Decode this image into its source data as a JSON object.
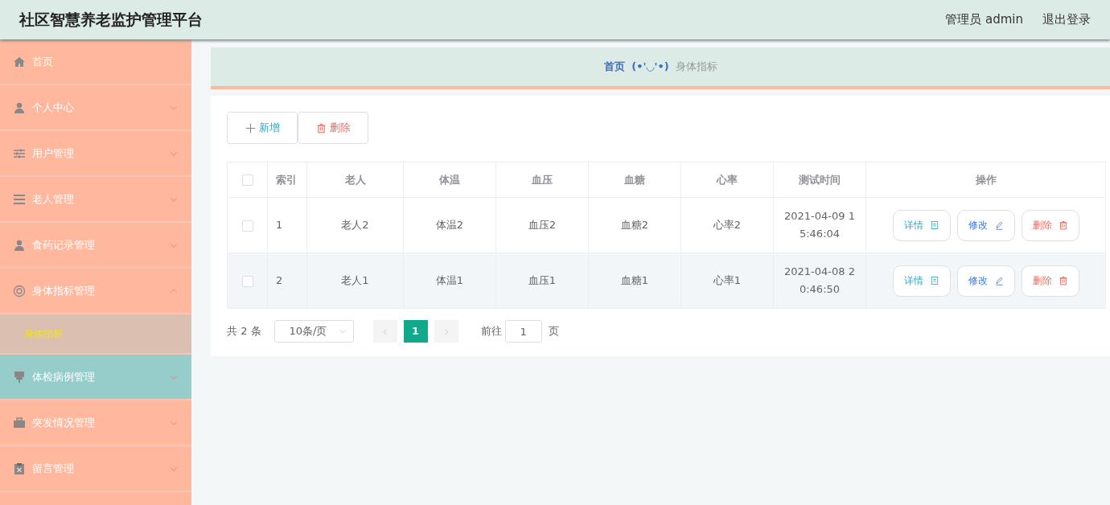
{
  "header": {
    "title": "社区智慧养老监护管理平台",
    "user": "管理员 admin",
    "logout": "退出登录"
  },
  "sidebar": {
    "items": [
      {
        "label": "首页",
        "hovered": false
      },
      {
        "label": "个人中心",
        "expanded": false,
        "hovered": false
      },
      {
        "label": "用户管理",
        "expanded": false,
        "hovered": false
      },
      {
        "label": "老人管理",
        "expanded": false,
        "hovered": false
      },
      {
        "label": "食药记录管理",
        "expanded": false,
        "hovered": false
      },
      {
        "label": "身体指标管理",
        "expanded": true,
        "hovered": false,
        "children": [
          {
            "label": "身体指标",
            "selected": true
          }
        ]
      },
      {
        "label": "体检病例管理",
        "expanded": false,
        "hovered": true
      },
      {
        "label": "突发情况管理",
        "expanded": false,
        "hovered": false
      },
      {
        "label": "留言管理",
        "expanded": false,
        "hovered": false
      }
    ]
  },
  "breadcrumb": {
    "home": "首页",
    "separator": "(•'◡'•)",
    "current": "身体指标"
  },
  "toolbar": {
    "add": "新增",
    "delete": "删除"
  },
  "table": {
    "select_all_checked": false,
    "columns": [
      "索引",
      "老人",
      "体温",
      "血压",
      "血糖",
      "心率",
      "测试时间",
      "操作"
    ],
    "rows": [
      {
        "checked": false,
        "cells": [
          "1",
          "老人2",
          "体温2",
          "血压2",
          "血糖2",
          "心率2",
          "2021-04-09 15:46:04"
        ],
        "actions": [
          "详情",
          "修改",
          "删除"
        ]
      },
      {
        "checked": false,
        "cells": [
          "2",
          "老人1",
          "体温1",
          "血压1",
          "血糖1",
          "心率1",
          "2021-04-08 20:46:50"
        ],
        "actions": [
          "详情",
          "修改",
          "删除"
        ]
      }
    ]
  },
  "pagination": {
    "total": "共 2 条",
    "page_size": "10条/页",
    "pages": [
      {
        "label": "1",
        "selected": true
      }
    ],
    "goto_label": "前往",
    "goto_value": "1",
    "goto_suffix": "页"
  }
}
